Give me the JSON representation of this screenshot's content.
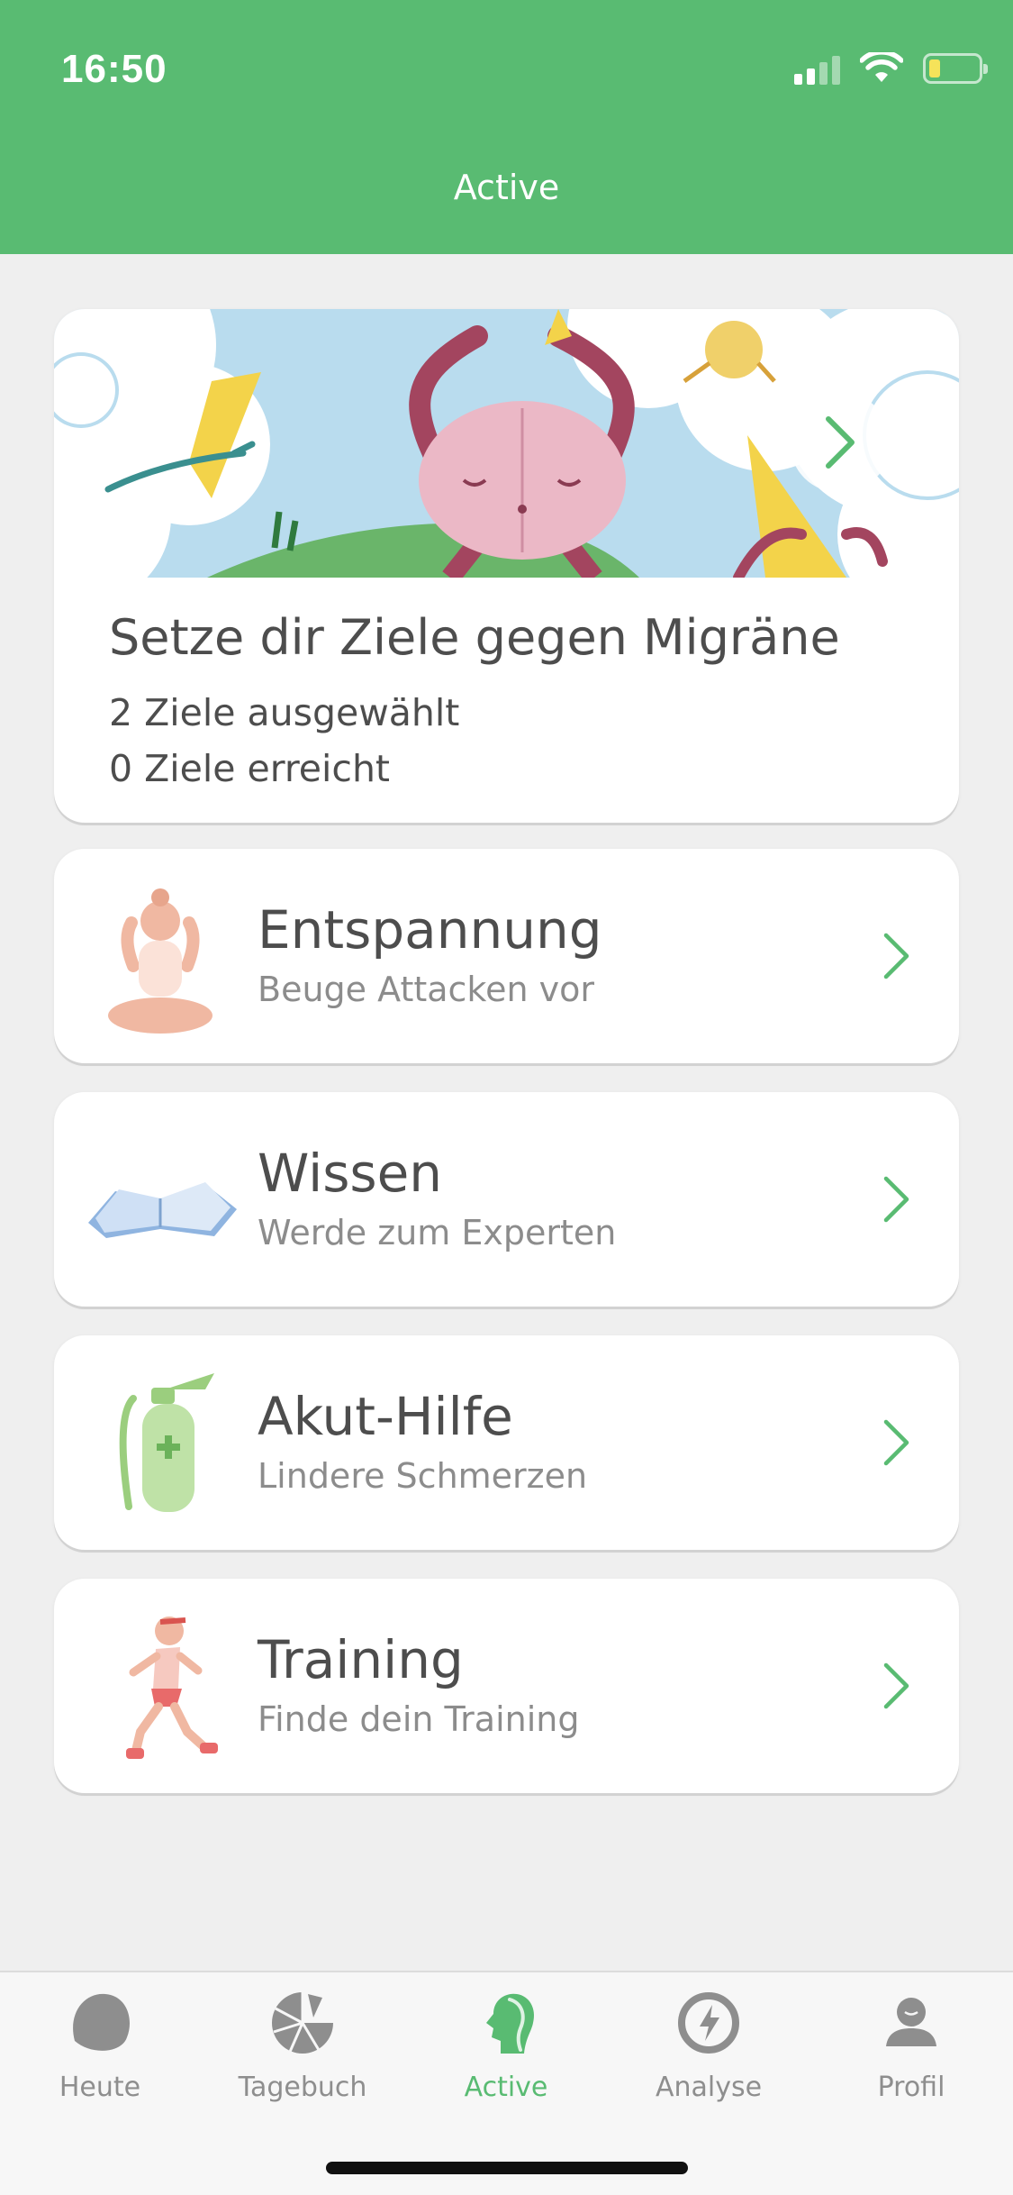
{
  "status_bar": {
    "time": "16:50"
  },
  "header": {
    "title": "Active"
  },
  "hero": {
    "title": "Setze dir Ziele gegen Migräne",
    "line1": "2 Ziele ausgewählt",
    "line2": "0 Ziele erreicht"
  },
  "cards": [
    {
      "title": "Entspannung",
      "subtitle": "Beuge Attacken vor",
      "icon": "meditating-person-icon"
    },
    {
      "title": "Wissen",
      "subtitle": "Werde zum Experten",
      "icon": "open-book-icon"
    },
    {
      "title": "Akut-Hilfe",
      "subtitle": "Lindere Schmerzen",
      "icon": "fire-extinguisher-icon"
    },
    {
      "title": "Training",
      "subtitle": "Finde dein Training",
      "icon": "running-person-icon"
    }
  ],
  "tabs": [
    {
      "label": "Heute",
      "icon": "blob-icon"
    },
    {
      "label": "Tagebuch",
      "icon": "diary-pie-icon"
    },
    {
      "label": "Active",
      "icon": "active-head-icon",
      "active": true
    },
    {
      "label": "Analyse",
      "icon": "lightning-circle-icon"
    },
    {
      "label": "Profil",
      "icon": "profile-icon"
    }
  ],
  "colors": {
    "brand_green": "#59bb72",
    "background": "#efefef",
    "text_dark": "#4d4d4d",
    "text_muted": "#8c8c8c",
    "tab_inactive": "#8e8e8e"
  }
}
